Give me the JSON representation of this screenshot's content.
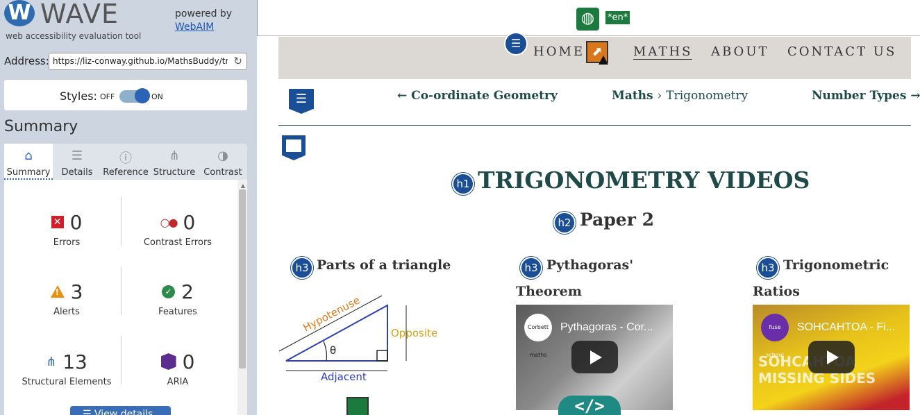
{
  "wave": {
    "logo_letter": "W",
    "title": "WAVE",
    "tagline": "web accessibility evaluation tool",
    "powered_by": "powered by",
    "webaim_link": "WebAIM",
    "address_label": "Address:",
    "address_value": "https://liz-conway.github.io/MathsBuddy/trigonometry.html",
    "styles_label": "Styles:",
    "styles_off": "OFF",
    "styles_on": "ON",
    "summary_title": "Summary",
    "tabs": [
      {
        "label": "Summary",
        "icon": "home-icon",
        "active": true
      },
      {
        "label": "Details",
        "icon": "list-icon",
        "active": false
      },
      {
        "label": "Reference",
        "icon": "info-icon",
        "active": false
      },
      {
        "label": "Structure",
        "icon": "structure-icon",
        "active": false
      },
      {
        "label": "Contrast",
        "icon": "contrast-icon",
        "active": false
      }
    ],
    "stats": {
      "errors": {
        "value": "0",
        "label": "Errors"
      },
      "contrast_errors": {
        "value": "0",
        "label": "Contrast Errors"
      },
      "alerts": {
        "value": "3",
        "label": "Alerts"
      },
      "features": {
        "value": "2",
        "label": "Features"
      },
      "structural": {
        "value": "13",
        "label": "Structural Elements"
      },
      "aria": {
        "value": "0",
        "label": "ARIA"
      }
    },
    "view_details_label": "View details",
    "colors": {
      "accent": "#2b63b5",
      "error": "#d11f2a",
      "alert": "#e8900c",
      "feature": "#2c8a4a",
      "aria": "#5b2d8f"
    }
  },
  "page": {
    "lang_tag": "*en*",
    "nav": {
      "home": "HOME",
      "maths": "MATHS",
      "about": "ABOUT",
      "contact": "CONTACT US"
    },
    "breadcrumbs": {
      "prev": "← Co-ordinate Geometry",
      "section": "Maths",
      "separator": "›",
      "current": "Trigonometry",
      "next": "Number Types →"
    },
    "h1_badge": "h1",
    "h1": "TRIGONOMETRY VIDEOS",
    "h2_badge": "h2",
    "h2": "Paper 2",
    "h3_badge": "h3",
    "h3_items": [
      {
        "line1": "Parts of a triangle",
        "line2": ""
      },
      {
        "line1": "Pythagoras'",
        "line2": "Theorem"
      },
      {
        "line1": "Trigonometric",
        "line2": "Ratios"
      }
    ],
    "triangle": {
      "hypotenuse": "Hypotenuse",
      "opposite": "Opposite",
      "adjacent": "Adjacent",
      "angle": "θ"
    },
    "videos": [
      {
        "title": "Pythagoras - Cor...",
        "channel": "Corbett maths"
      },
      {
        "title": "SOHCAHTOA - Fi...",
        "channel": "fuse school",
        "overlay": "SOHCAHTOA MISSING SIDES"
      }
    ],
    "code_badge": "</>",
    "colors": {
      "heading": "#1f4a4a",
      "nav_band": "#dcd9d5",
      "wave_badge": "#1a4e97",
      "lang": "#1d7a3e"
    }
  }
}
